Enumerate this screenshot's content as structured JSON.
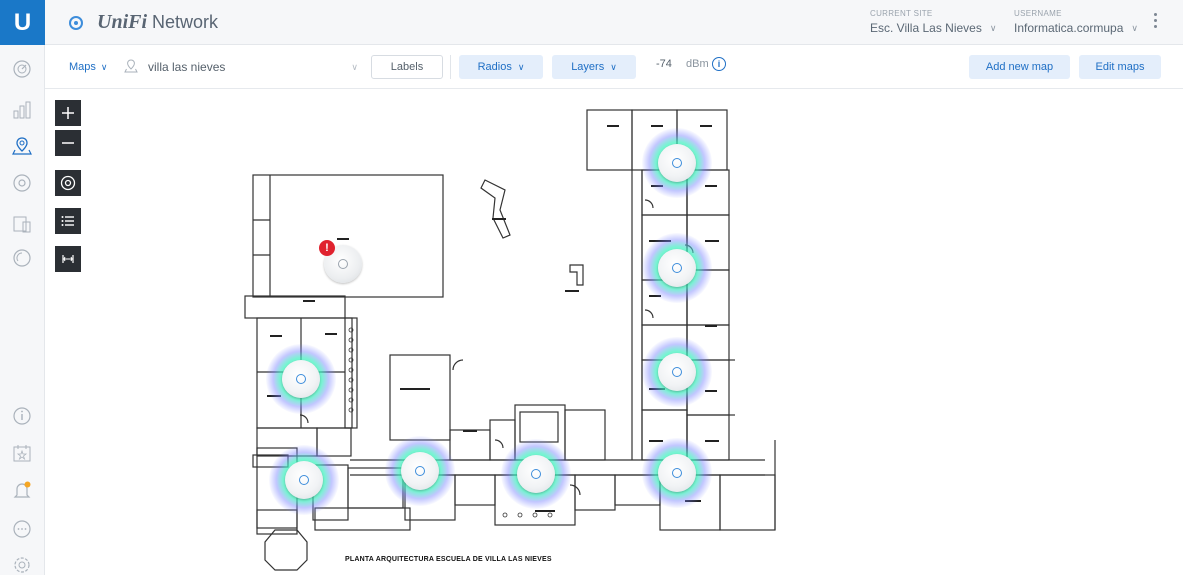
{
  "app": {
    "brand_unifi": "UniFi",
    "brand_network": "Network",
    "logo_letter": "U"
  },
  "header": {
    "site_caption": "CURRENT SITE",
    "site_value": "Esc. Villa Las Nieves",
    "user_caption": "USERNAME",
    "user_value": "Informatica.cormupa"
  },
  "toolbar": {
    "maps_label": "Maps",
    "map_name": "villa las nieves",
    "labels_button": "Labels",
    "radios_button": "Radios",
    "layers_button": "Layers",
    "dbm_value": "-74",
    "dbm_unit": "dBm",
    "add_map_button": "Add new map",
    "edit_maps_button": "Edit maps"
  },
  "sidebar": {
    "items": [
      {
        "name": "dashboard-icon"
      },
      {
        "name": "statistics-icon"
      },
      {
        "name": "map-icon",
        "active": true
      },
      {
        "name": "devices-icon"
      },
      {
        "name": "clients-icon"
      },
      {
        "name": "insights-icon"
      },
      {
        "name": "events-icon"
      },
      {
        "name": "alerts-icon"
      },
      {
        "name": "chat-icon"
      },
      {
        "name": "settings-icon"
      }
    ]
  },
  "map": {
    "plan_title": "PLANTA ARQUITECTURA ESCUELA DE VILLA LAS NIEVES",
    "alert_badge": "!",
    "access_points": [
      {
        "status": "offline"
      },
      {
        "status": "online"
      },
      {
        "status": "online"
      },
      {
        "status": "online"
      },
      {
        "status": "online"
      },
      {
        "status": "online"
      },
      {
        "status": "online"
      },
      {
        "status": "online"
      },
      {
        "status": "online"
      }
    ]
  },
  "colors": {
    "brand_blue": "#1a78c8",
    "accent_blue": "#1f6fc5",
    "alert_red": "#e0222e",
    "coverage_green": "#3cf0be"
  }
}
